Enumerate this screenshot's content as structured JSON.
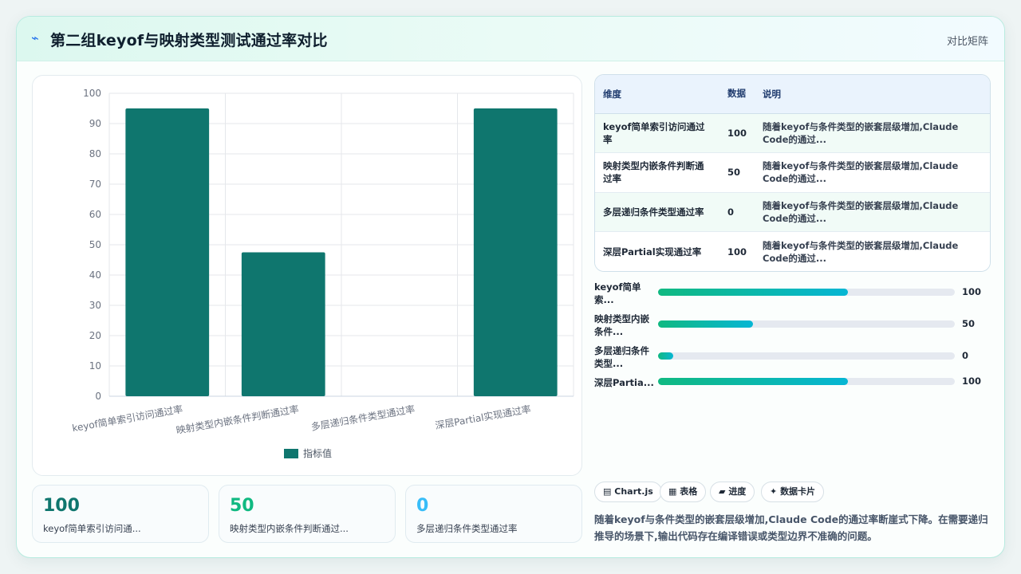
{
  "header": {
    "icon": "bolt-icon",
    "title": "第二组keyof与映射类型测试通过率对比",
    "right_label": "对比矩阵"
  },
  "chart_data": {
    "type": "bar",
    "categories": [
      "keyof简单索引访问通过率",
      "映射类型内嵌条件判断通过率",
      "多层递归条件类型通过率",
      "深层Partial实现通过率"
    ],
    "series": [
      {
        "name": "指标值",
        "values": [
          95,
          47.5,
          0,
          95
        ],
        "color": "#0f766e"
      }
    ],
    "ylim": [
      0,
      100
    ],
    "yticks": [
      0,
      10,
      20,
      30,
      40,
      50,
      60,
      70,
      80,
      90,
      100
    ],
    "legend": "bottom",
    "grid": true
  },
  "stats": [
    {
      "value": "100",
      "label": "keyof简单索引访问通...",
      "color": "#0f766e"
    },
    {
      "value": "50",
      "label": "映射类型内嵌条件判断通过...",
      "color": "#10b981"
    },
    {
      "value": "0",
      "label": "多层递归条件类型通过率",
      "color": "#38bdf8"
    }
  ],
  "table": {
    "headers": [
      "维度",
      "数据",
      "说明"
    ],
    "rows": [
      {
        "dim": "keyof简单索引访问通过率",
        "value": "100",
        "note": "随着keyof与条件类型的嵌套层级增加,Claude Code的通过..."
      },
      {
        "dim": "映射类型内嵌条件判断通过率",
        "value": "50",
        "note": "随着keyof与条件类型的嵌套层级增加,Claude Code的通过..."
      },
      {
        "dim": "多层递归条件类型通过率",
        "value": "0",
        "note": "随着keyof与条件类型的嵌套层级增加,Claude Code的通过..."
      },
      {
        "dim": "深层Partial实现通过率",
        "value": "100",
        "note": "随着keyof与条件类型的嵌套层级增加,Claude Code的通过..."
      }
    ]
  },
  "progress": [
    {
      "label": "keyof简单索...",
      "value": "100",
      "fraction": 0.64
    },
    {
      "label": "映射类型内嵌条件...",
      "value": "50",
      "fraction": 0.32
    },
    {
      "label": "多层递归条件类型...",
      "value": "0",
      "fraction": 0.05
    },
    {
      "label": "深层Partia...",
      "value": "100",
      "fraction": 0.64
    }
  ],
  "tags": [
    {
      "icon": "chart-icon",
      "glyph": "▤",
      "label": "Chart.js"
    },
    {
      "icon": "table-icon",
      "glyph": "▦",
      "label": "表格"
    },
    {
      "icon": "progress-icon",
      "glyph": "▰",
      "label": "进度"
    },
    {
      "icon": "sparkle-icon",
      "glyph": "✦",
      "label": "数据卡片"
    }
  ],
  "summary": "随着keyof与条件类型的嵌套层级增加,Claude Code的通过率断崖式下降。在需要递归推导的场景下,输出代码存在编译错误或类型边界不准确的问题。"
}
